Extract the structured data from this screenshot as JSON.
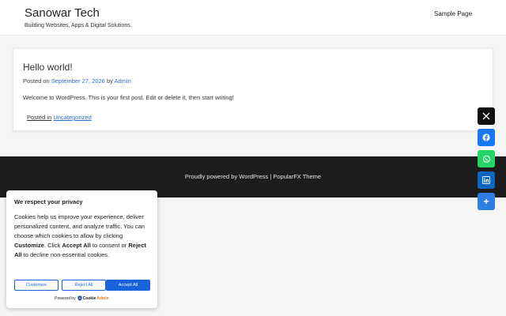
{
  "header": {
    "site_title": "Sanowar Tech",
    "tagline": "Building Websites, Apps & Digital Solutions.",
    "nav": [
      "Sample Page"
    ]
  },
  "post": {
    "title": "Hello world!",
    "meta_prefix": "Posted on",
    "date": "September 27, 2026",
    "by_label": "by",
    "author": "Admin",
    "excerpt": "Welcome to WordPress. This is your first post. Edit or delete it, then start writing!",
    "category_prefix": "Posted in",
    "category": "Uncategorized"
  },
  "footer": {
    "text": "Proudly powered by WordPress | PopularFX Theme"
  },
  "share": {
    "icons": [
      "x-icon",
      "facebook-icon",
      "whatsapp-icon",
      "linkedin-icon",
      "more-icon"
    ],
    "more_label": "+"
  },
  "cookie": {
    "title": "We respect your privacy",
    "body_1": "Cookies help us improve your experience, deliver personalized content, and analyze traffic. You can choose which cookies to allow by clicking ",
    "customize_word": "Customize",
    "body_2": ". Click ",
    "accept_word": "Accept All",
    "body_3": " to consent or ",
    "reject_word": "Reject All",
    "body_4": " to decline non-essential cookies.",
    "btn_customize": "Customize",
    "btn_reject": "Reject All",
    "btn_accept": "Accept All",
    "powered_by": "Powered by",
    "brand_cookie": "Cookie",
    "brand_admin": "Admin",
    "accent_color": "#1863dc"
  }
}
